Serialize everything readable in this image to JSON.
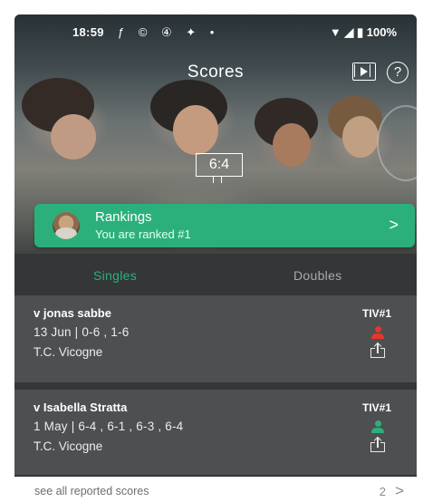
{
  "status_bar": {
    "time": "18:59",
    "status_icons": [
      "sync-icon",
      "data-saver-icon",
      "calendar-icon",
      "teams-icon",
      "dot-icon"
    ],
    "status_icon_glyphs": "ƒ © ④ ✦ •",
    "battery": "100%"
  },
  "header": {
    "title": "Scores",
    "scoreboard_text": "6:4"
  },
  "rankings": {
    "title": "Rankings",
    "subtitle": "You are ranked #1"
  },
  "tabs": [
    {
      "label": "Singles",
      "selected": true
    },
    {
      "label": "Doubles",
      "selected": false
    }
  ],
  "scores": [
    {
      "opponent": "v jonas sabbe",
      "detail": "13 Jun | 0-6 , 1-6",
      "club": "T.C. Vicogne",
      "tag": "TIV#1",
      "result_color": "#e8352a"
    },
    {
      "opponent": "v Isabella Stratta",
      "detail": "1 May | 6-4 , 6-1 , 6-3 , 6-4",
      "club": "T.C. Vicogne",
      "tag": "TIV#1",
      "result_color": "#2bb07c"
    }
  ],
  "footer": {
    "label": "see all reported scores",
    "count": "2"
  },
  "colors": {
    "accent": "#2bb07c",
    "loss": "#e8352a",
    "row_bg": "#4d4f51",
    "tab_bg": "#343638"
  }
}
